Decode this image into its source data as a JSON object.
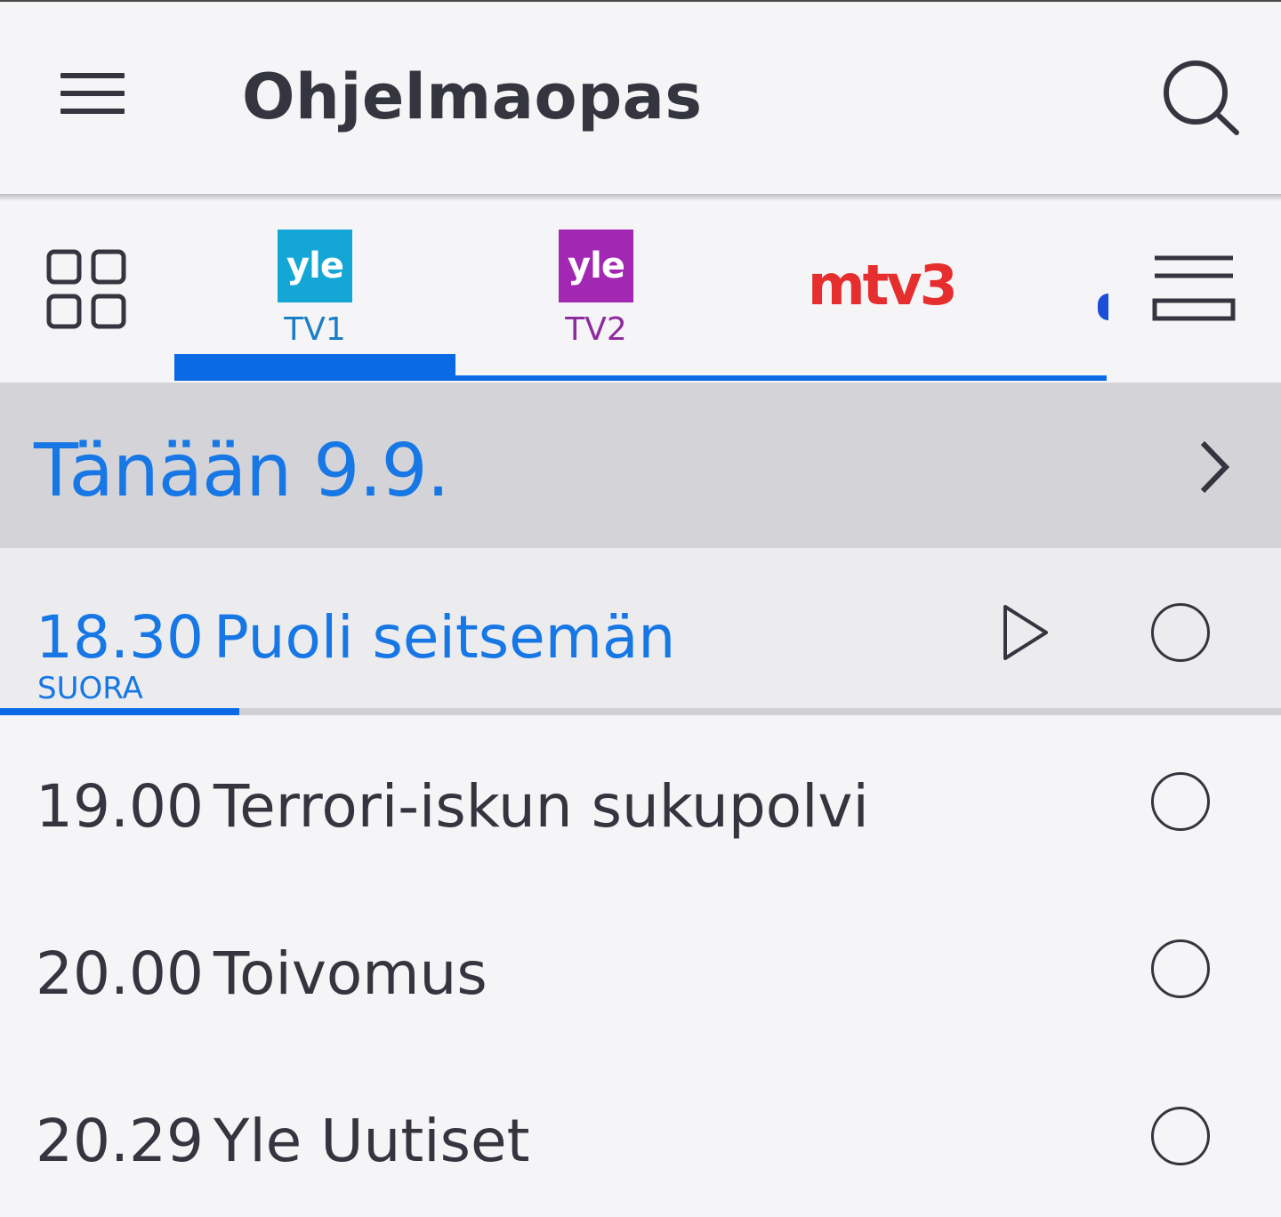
{
  "header": {
    "title": "Ohjelmaopas",
    "menu_icon": "menu-icon",
    "search_icon": "search-icon"
  },
  "channels": {
    "grid_icon": "grid-icon",
    "list_icon": "list-icon",
    "tabs": [
      {
        "logo_text": "yle",
        "label": "TV1",
        "logo_color": "#14a6d4",
        "selected": true
      },
      {
        "logo_text": "yle",
        "label": "TV2",
        "logo_color": "#a228b3",
        "selected": false
      },
      {
        "logo_text": "mtv3",
        "label": "",
        "logo_color": "#e62e2e",
        "selected": false
      }
    ],
    "accent_color": "#0a6ae6"
  },
  "date": {
    "label": "Tänään 9.9.",
    "chevron_icon": "chevron-right-icon"
  },
  "programs": [
    {
      "time": "18.30",
      "title": "Puoli seitsemän",
      "badge": "SUORA",
      "live": true,
      "progress": 0.187
    },
    {
      "time": "19.00",
      "title": "Terrori-iskun sukupolvi",
      "live": false
    },
    {
      "time": "20.00",
      "title": "Toivomus",
      "live": false
    },
    {
      "time": "20.29",
      "title": "Yle Uutiset",
      "live": false
    }
  ]
}
